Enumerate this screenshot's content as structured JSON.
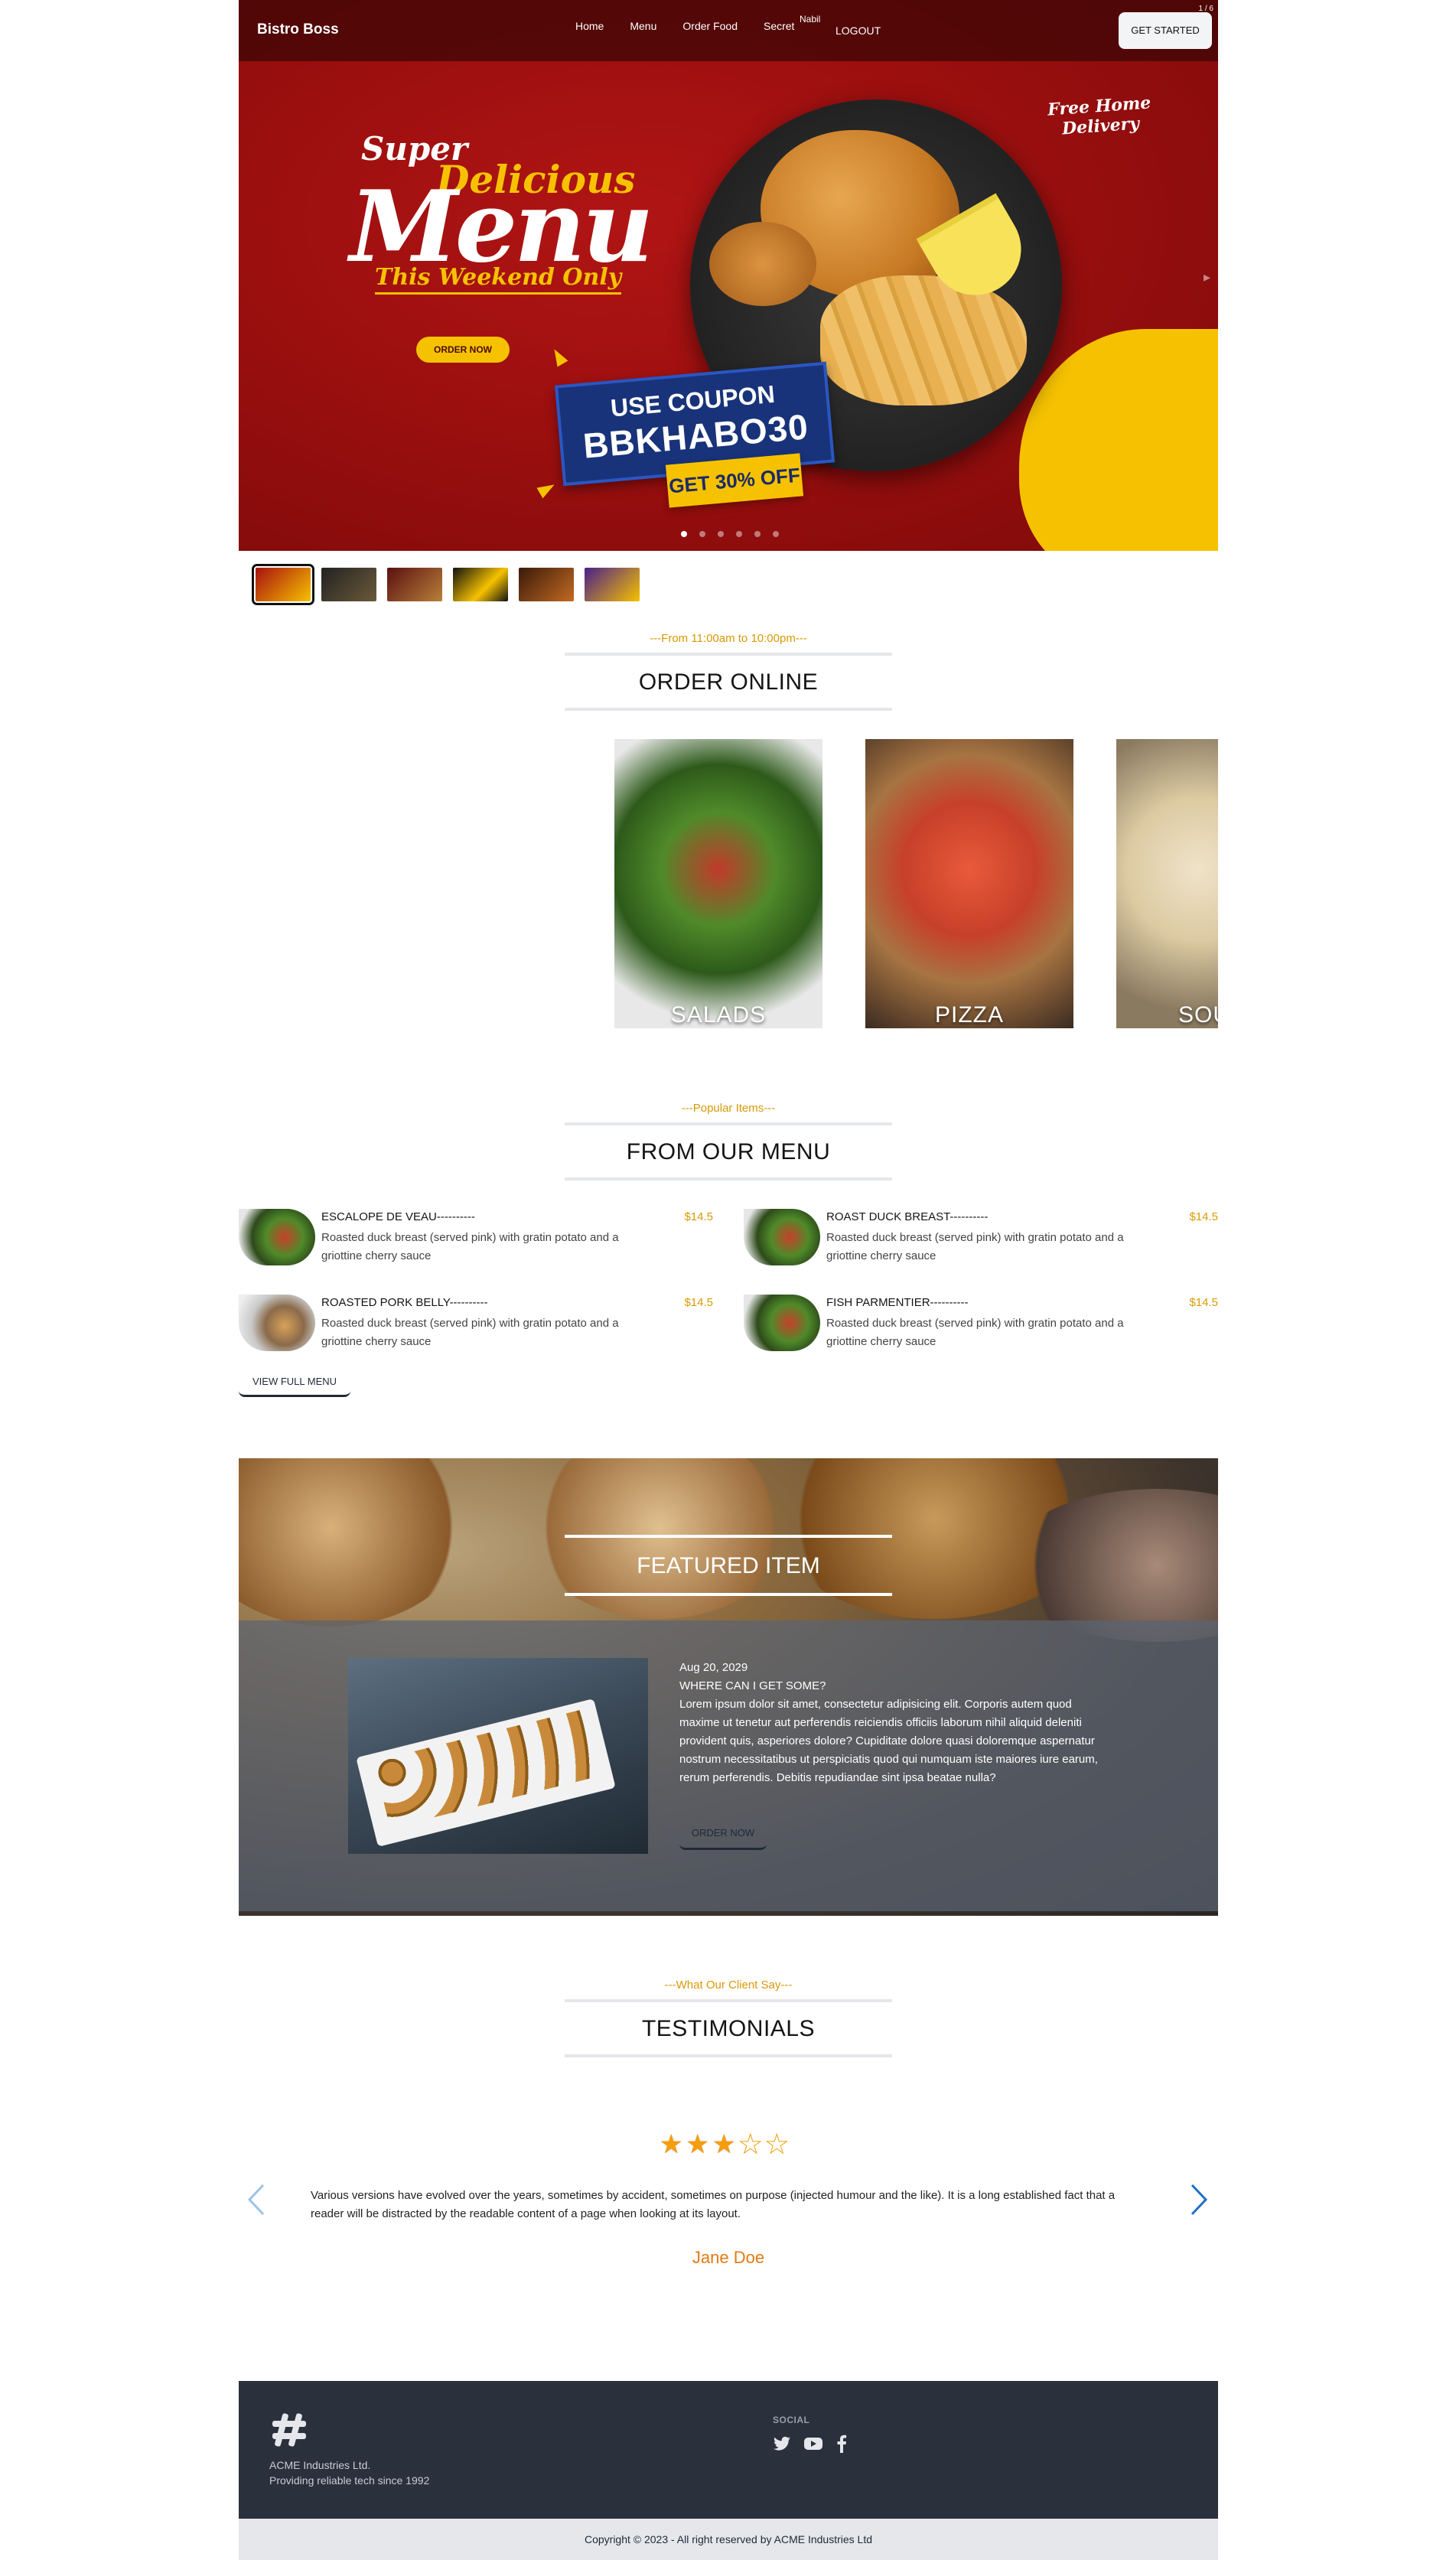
{
  "nav": {
    "brand": "Bistro Boss",
    "links": [
      "Home",
      "Menu",
      "Order Food",
      "Secret"
    ],
    "user_name": "Nabil",
    "logout": "LOGOUT",
    "cta": "GET STARTED",
    "page_indicator": "1 / 6"
  },
  "hero": {
    "super": "Super",
    "delicious": "Delicious",
    "menu": "Menu",
    "weekend": "This Weekend Only",
    "order_now": "ORDER NOW",
    "coupon_line1": "USE COUPON",
    "coupon_code": "BBKHABO30",
    "discount": "GET 30% OFF",
    "free_delivery_1": "Free Home",
    "free_delivery_2": "Delivery",
    "slide_count": 6,
    "active_slide": 1
  },
  "order_online": {
    "subtitle": "---From 11:00am to 10:00pm---",
    "title": "ORDER ONLINE",
    "categories": [
      "SALADS",
      "PIZZA",
      "SOUPS"
    ]
  },
  "from_menu": {
    "subtitle": "---Popular Items---",
    "title": "FROM OUR MENU",
    "items": [
      {
        "name": "ESCALOPE DE VEAU----------",
        "desc": "Roasted duck breast (served pink) with gratin potato and a griottine cherry sauce",
        "price": "$14.5"
      },
      {
        "name": "ROAST DUCK BREAST----------",
        "desc": "Roasted duck breast (served pink) with gratin potato and a griottine cherry sauce",
        "price": "$14.5"
      },
      {
        "name": "ROASTED PORK BELLY----------",
        "desc": "Roasted duck breast (served pink) with gratin potato and a griottine cherry sauce",
        "price": "$14.5"
      },
      {
        "name": "FISH PARMENTIER----------",
        "desc": "Roasted duck breast (served pink) with gratin potato and a griottine cherry sauce",
        "price": "$14.5"
      }
    ],
    "view_full": "VIEW FULL MENU"
  },
  "featured": {
    "title": "FEATURED ITEM",
    "date": "Aug 20, 2029",
    "question": "WHERE CAN I GET SOME?",
    "body": "Lorem ipsum dolor sit amet, consectetur adipisicing elit. Corporis autem quod maxime ut tenetur aut perferendis reiciendis officiis laborum nihil aliquid deleniti provident quis, asperiores dolore? Cupiditate dolore quasi doloremque aspernatur nostrum necessitatibus ut perspiciatis quod qui numquam iste maiores iure earum, rerum perferendis. Debitis repudiandae sint ipsa beatae nulla?",
    "button": "ORDER NOW"
  },
  "testimonials": {
    "subtitle": "---What Our Client Say---",
    "title": "TESTIMONIALS",
    "rating": 3,
    "rating_max": 5,
    "text": "Various versions have evolved over the years, sometimes by accident, sometimes on purpose (injected humour and the like). It is a long established fact that a reader will be distracted by the readable content of a page when looking at its layout.",
    "author": "Jane Doe"
  },
  "footer": {
    "company": "ACME Industries Ltd.",
    "tagline": "Providing reliable tech since 1992",
    "social_heading": "SOCIAL",
    "social_icons": [
      "twitter-icon",
      "youtube-icon",
      "facebook-icon"
    ],
    "copyright": "Copyright © 2023 - All right reserved by ACME Industries Ltd"
  },
  "colors": {
    "accent": "#d99904",
    "hero_red": "#9c0f0f",
    "hero_yellow": "#f6c200",
    "footer_bg": "#2a303c",
    "author": "#e17a0f"
  }
}
